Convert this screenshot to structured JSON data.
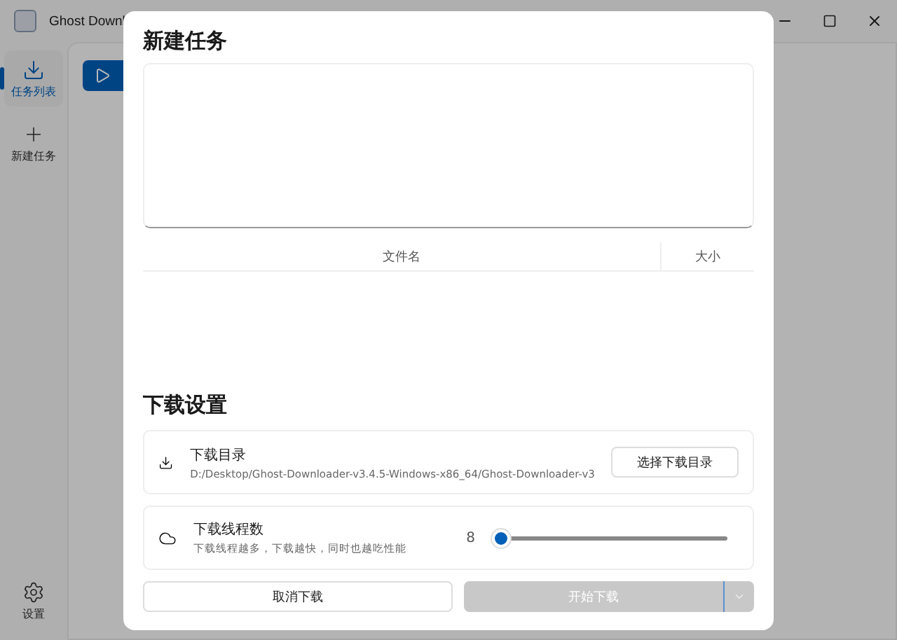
{
  "window": {
    "title": "Ghost Downl"
  },
  "sidebar": {
    "items": [
      {
        "label": "任务列表",
        "selected": true
      },
      {
        "label": "新建任务",
        "selected": false
      }
    ],
    "bottom_items": [
      {
        "label": "设置",
        "selected": false
      }
    ]
  },
  "dialog": {
    "title": "新建任务",
    "file_table": {
      "columns": [
        "文件名",
        "大小"
      ]
    },
    "settings_title": "下载设置",
    "settings": [
      {
        "kind": "folder",
        "title": "下载目录",
        "description": "D:/Desktop/Ghost-Downloader-v3.4.5-Windows-x86_64/Ghost-Downloader-v3",
        "button": "选择下载目录"
      },
      {
        "kind": "slider",
        "title": "下载线程数",
        "description": "下载线程越多，下载越快，同时也越吃性能",
        "reading": "8",
        "level": 0.0
      }
    ],
    "cancel_button": {
      "label": "取消下载"
    },
    "start_button": {
      "label": "开始下载",
      "disabled": true
    }
  }
}
